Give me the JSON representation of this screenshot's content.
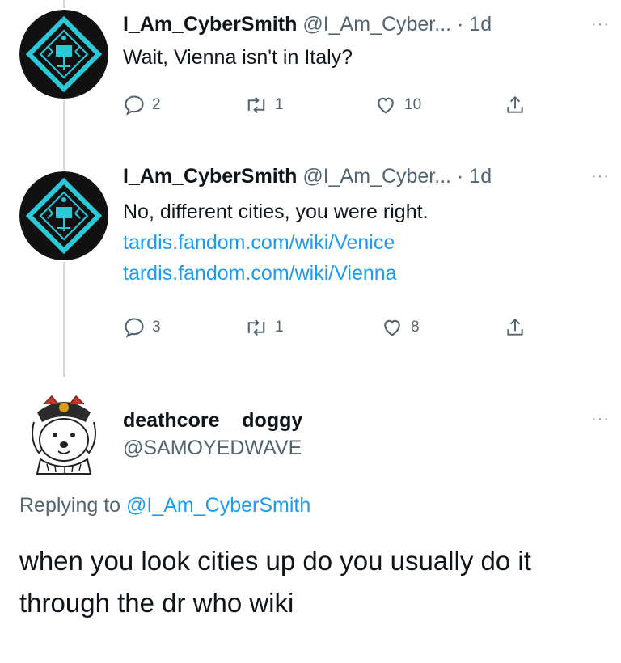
{
  "tweets": [
    {
      "name": "I_Am_CyberSmith",
      "handle": "@I_Am_Cyber...",
      "time": "· 1d",
      "more": "···",
      "text": "Wait, Vienna isn't in Italy?",
      "links": [],
      "replies": "2",
      "retweets": "1",
      "likes": "10"
    },
    {
      "name": "I_Am_CyberSmith",
      "handle": "@I_Am_Cyber...",
      "time": "· 1d",
      "more": "···",
      "text": "No, different cities, you were right.",
      "links": [
        "tardis.fandom.com/wiki/Venice",
        "tardis.fandom.com/wiki/Vienna"
      ],
      "replies": "3",
      "retweets": "1",
      "likes": "8"
    }
  ],
  "reply": {
    "name": "deathcore__doggy",
    "handle": "@SAMOYEDWAVE",
    "more": "···",
    "replying_prefix": "Replying to",
    "replying_to": "@I_Am_CyberSmith",
    "text": "when you look cities up do you usually do it through the dr who wiki"
  },
  "colors": {
    "link": "#1d9bf0",
    "secondary_text": "#536471",
    "avatar_accent": "#2bc8d8"
  },
  "icons": [
    "reply-icon",
    "retweet-icon",
    "like-icon",
    "share-icon",
    "more-icon"
  ]
}
